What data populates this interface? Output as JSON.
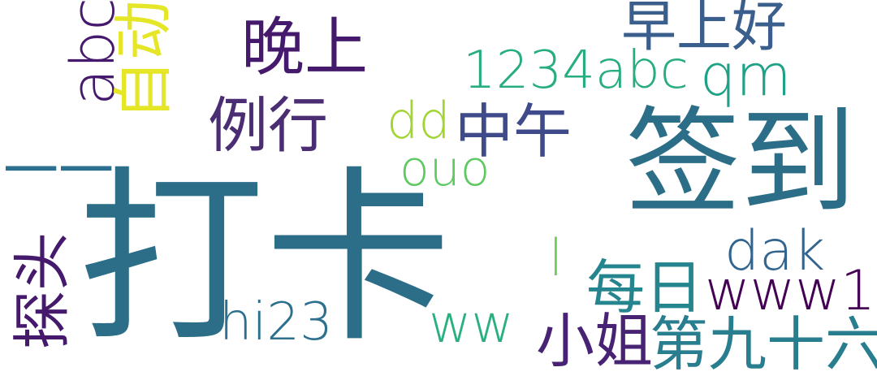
{
  "words": [
    {
      "id": "daka",
      "text": "打卡",
      "color": "#2c6e87"
    },
    {
      "id": "qiandao",
      "text": "签到",
      "color": "#2c6e87"
    },
    {
      "id": "zaoshanghao",
      "text": "早上好",
      "color": "#3b5f8d"
    },
    {
      "id": "wanshang",
      "text": "晚上",
      "color": "#45196c"
    },
    {
      "id": "abc",
      "text": "abc",
      "color": "#45196c"
    },
    {
      "id": "zidong",
      "text": "自动",
      "color": "#e6e629"
    },
    {
      "id": "n1234abc",
      "text": "1234abc",
      "color": "#27ad81"
    },
    {
      "id": "qm",
      "text": "qm",
      "color": "#1fa187"
    },
    {
      "id": "lixing",
      "text": "例行",
      "color": "#4b2d74"
    },
    {
      "id": "dd",
      "text": "dd",
      "color": "#a2d533"
    },
    {
      "id": "zhongwu",
      "text": "中午",
      "color": "#3e4a89"
    },
    {
      "id": "ouo",
      "text": "ouo",
      "color": "#5ec962"
    },
    {
      "id": "dash",
      "text": "一一",
      "color": "#2d6f8e"
    },
    {
      "id": "tantou",
      "text": "探头",
      "color": "#45196c"
    },
    {
      "id": "l",
      "text": "l",
      "color": "#6ece58"
    },
    {
      "id": "dak",
      "text": "dak",
      "color": "#32648e"
    },
    {
      "id": "meiri",
      "text": "每日",
      "color": "#25858e"
    },
    {
      "id": "www1",
      "text": "www1",
      "color": "#440154"
    },
    {
      "id": "hi23",
      "text": "hi23",
      "color": "#2d708e"
    },
    {
      "id": "ww",
      "text": "ww",
      "color": "#2ab07f"
    },
    {
      "id": "xiaojie",
      "text": "小姐",
      "color": "#482374"
    },
    {
      "id": "dijiushiliu",
      "text": "第九十六",
      "color": "#287d8e"
    }
  ]
}
